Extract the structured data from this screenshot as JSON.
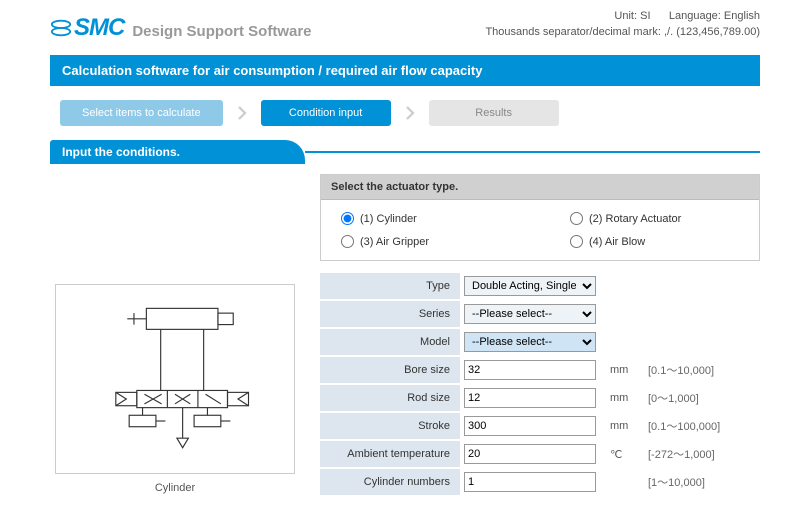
{
  "header": {
    "logo_text": "SMC",
    "app_title": "Design Support Software",
    "unit_label": "Unit: ",
    "unit_value": "SI",
    "lang_label": "Language: ",
    "lang_value": "English",
    "separator_note": "Thousands separator/decimal mark: ,/. (123,456,789.00)"
  },
  "title_bar": "Calculation software for air consumption / required air flow capacity",
  "steps": {
    "s1": "Select items to calculate",
    "s2": "Condition input",
    "s3": "Results"
  },
  "section_header": "Input the conditions.",
  "actuator": {
    "header": "Select the actuator type.",
    "options": {
      "o1": "(1) Cylinder",
      "o2": "(2) Rotary Actuator",
      "o3": "(3) Air Gripper",
      "o4": "(4) Air Blow"
    },
    "selected": "1"
  },
  "diagram_caption": "Cylinder",
  "form": {
    "type": {
      "label": "Type",
      "value": "Double Acting, Single Rod"
    },
    "series": {
      "label": "Series",
      "value": "--Please select--"
    },
    "model": {
      "label": "Model",
      "value": "--Please select--"
    },
    "bore": {
      "label": "Bore size",
      "value": "32",
      "unit": "mm",
      "range": "[0.1～10,000]"
    },
    "rod": {
      "label": "Rod size",
      "value": "12",
      "unit": "mm",
      "range": "[0～1,000]"
    },
    "stroke": {
      "label": "Stroke",
      "value": "300",
      "unit": "mm",
      "range": "[0.1～100,000]"
    },
    "temp": {
      "label": "Ambient temperature",
      "value": "20",
      "unit": "℃",
      "range": "[-272～1,000]"
    },
    "count": {
      "label": "Cylinder numbers",
      "value": "1",
      "unit": "",
      "range": "[1～10,000]"
    }
  }
}
